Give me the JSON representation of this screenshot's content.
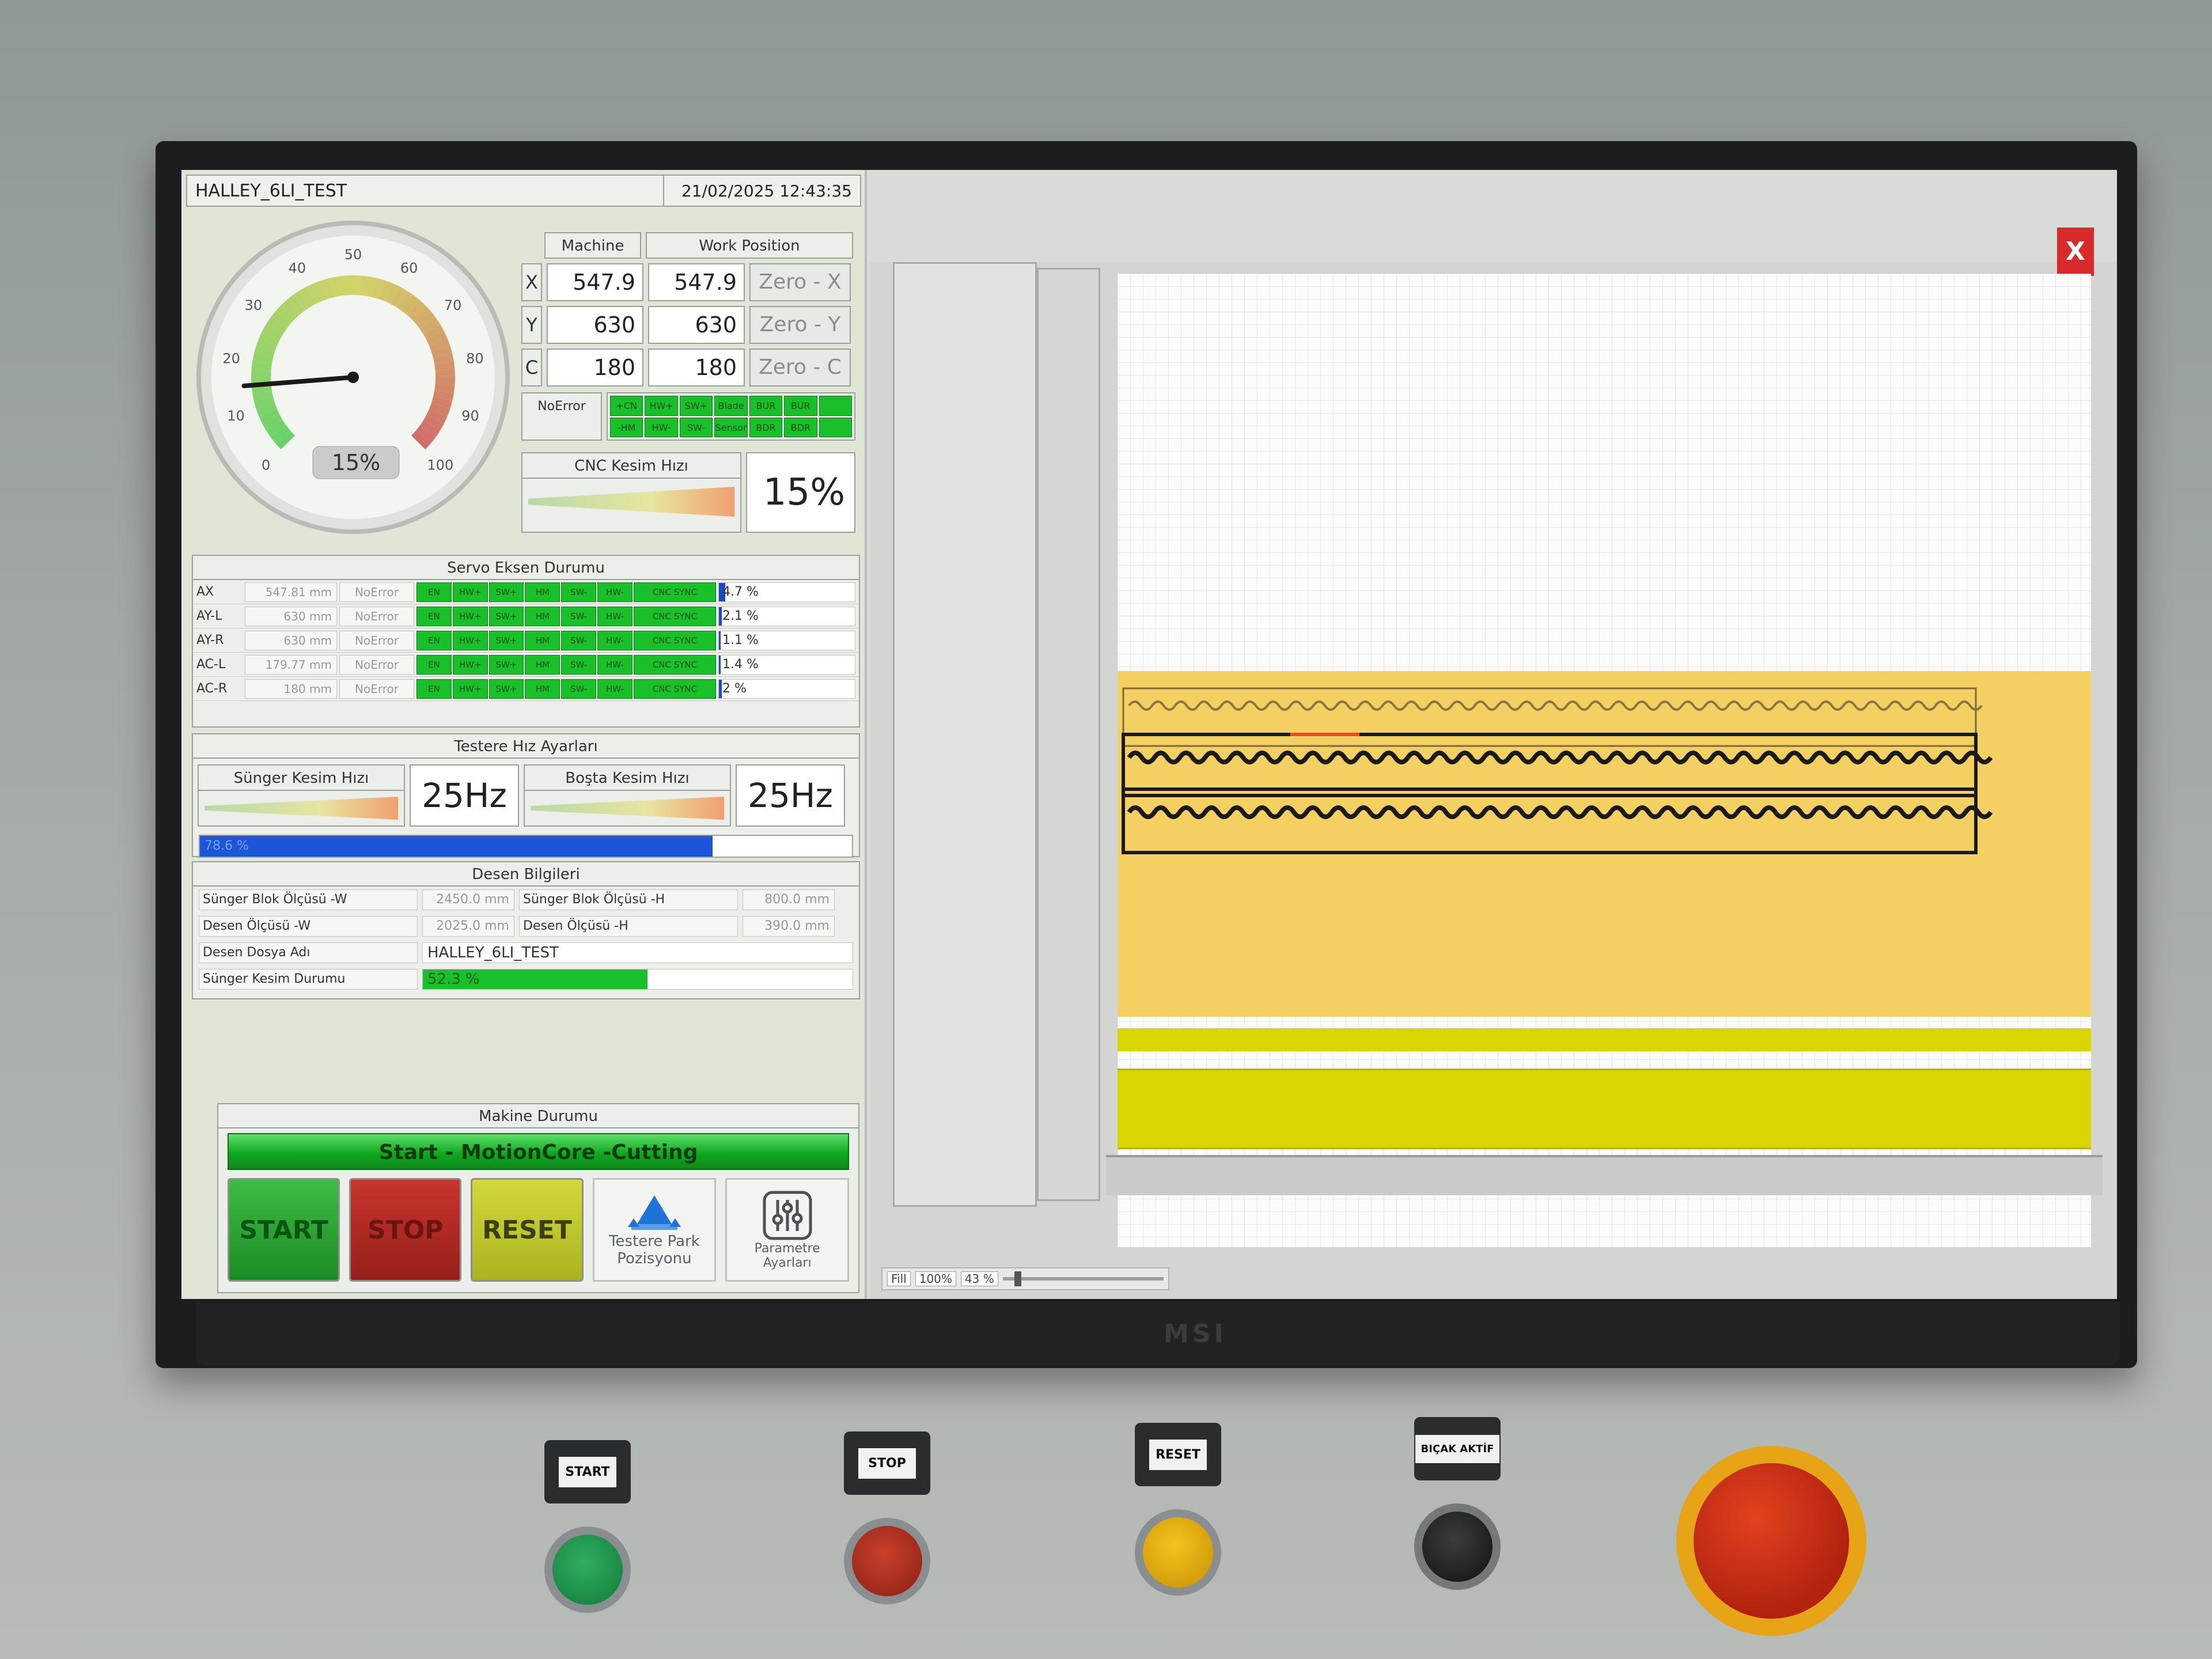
{
  "window": {
    "title": "HALLEY_6LI_TEST",
    "datetime": "21/02/2025 12:43:35"
  },
  "gauge": {
    "ticks": [
      "0",
      "10",
      "20",
      "30",
      "40",
      "50",
      "60",
      "70",
      "80",
      "90",
      "100"
    ],
    "value_label": "15%",
    "value": 15
  },
  "position": {
    "col_machine": "Machine",
    "col_work": "Work Position",
    "rows": [
      {
        "axis": "X",
        "machine": "547.9",
        "work": "547.9",
        "zero": "Zero - X"
      },
      {
        "axis": "Y",
        "machine": "630",
        "work": "630",
        "zero": "Zero - Y"
      },
      {
        "axis": "C",
        "machine": "180",
        "work": "180",
        "zero": "Zero - C"
      }
    ],
    "error_label": "NoError",
    "leds": [
      "+CN",
      "HW+",
      "SW+",
      "Blade",
      "BUR",
      "BUR",
      "-HM",
      "HW-",
      "SW-",
      "Sensor",
      "BDR",
      "BDR"
    ]
  },
  "cnc": {
    "label": "CNC Kesim Hızı",
    "value": "15%"
  },
  "servo": {
    "title": "Servo Eksen Durumu",
    "led_labels": [
      "EN",
      "HW+",
      "SW+",
      "HM",
      "SW-",
      "HW-",
      "CNC SYNC"
    ],
    "rows": [
      {
        "name": "AX",
        "mm": "547.81 mm",
        "err": "NoError",
        "pct": "4.7 %",
        "pct_value": 4.7
      },
      {
        "name": "AY-L",
        "mm": "630 mm",
        "err": "NoError",
        "pct": "2.1 %",
        "pct_value": 2.1
      },
      {
        "name": "AY-R",
        "mm": "630 mm",
        "err": "NoError",
        "pct": "1.1 %",
        "pct_value": 1.1
      },
      {
        "name": "AC-L",
        "mm": "179.77 mm",
        "err": "NoError",
        "pct": "1.4 %",
        "pct_value": 1.4
      },
      {
        "name": "AC-R",
        "mm": "180 mm",
        "err": "NoError",
        "pct": "2 %",
        "pct_value": 2
      }
    ]
  },
  "saw": {
    "title": "Testere Hız Ayarları",
    "sunger_label": "Sünger Kesim Hızı",
    "sunger_value": "25Hz",
    "bosta_label": "Boşta Kesim Hızı",
    "bosta_value": "25Hz",
    "progress_label": "78.6 %",
    "progress_value": 78.6
  },
  "desen": {
    "title": "Desen Bilgileri",
    "blok_w_label": "Sünger Blok Ölçüsü -W",
    "blok_w": "2450.0 mm",
    "blok_h_label": "Sünger Blok Ölçüsü -H",
    "blok_h": "800.0 mm",
    "desen_w_label": "Desen Ölçüsü -W",
    "desen_w": "2025.0 mm",
    "desen_h_label": "Desen Ölçüsü -H",
    "desen_h": "390.0 mm",
    "file_label": "Desen Dosya Adı",
    "file": "HALLEY_6LI_TEST",
    "cut_label": "Sünger Kesim Durumu",
    "cut_pct": "52.3 %",
    "cut_value": 52.3
  },
  "machine": {
    "title": "Makine Durumu",
    "status": "Start - MotionCore -Cutting",
    "start": "START",
    "stop": "STOP",
    "reset": "RESET",
    "park_line1": "Testere Park",
    "park_line2": "Pozisyonu",
    "param_line1": "Parametre",
    "param_line2": "Ayarları"
  },
  "viewer": {
    "close": "X",
    "fill": "Fill",
    "zoom100": "100%",
    "zoom_pct": "43 %"
  },
  "panel": {
    "brand": "MSI",
    "btn_start": "START",
    "btn_stop": "STOP",
    "btn_reset": "RESET",
    "btn_knife": "BIÇAK AKTİF"
  },
  "colors": {
    "led_green": "#19c02a",
    "start_green": "#1c8c24",
    "stop_red": "#961f1a",
    "reset_yellow": "#aab420",
    "foam_yellow": "#f4d062",
    "progress_blue": "#1a56d8"
  }
}
